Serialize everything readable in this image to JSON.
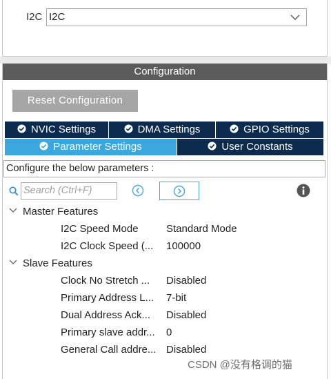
{
  "mode": {
    "label": "I2C",
    "selected": "I2C"
  },
  "config": {
    "header": "Configuration",
    "reset_button": "Reset Configuration",
    "tabs": [
      {
        "label": "NVIC Settings",
        "checked": true,
        "active": false
      },
      {
        "label": "DMA Settings",
        "checked": true,
        "active": false
      },
      {
        "label": "GPIO Settings",
        "checked": true,
        "active": false
      },
      {
        "label": "Parameter Settings",
        "checked": true,
        "active": true
      },
      {
        "label": "User Constants",
        "checked": true,
        "active": false
      }
    ],
    "description": "Configure the below parameters :",
    "search_placeholder": "Search (Ctrl+F)"
  },
  "tree": {
    "master": {
      "title": "Master Features",
      "params": [
        {
          "name": "I2C Speed Mode",
          "value": "Standard Mode"
        },
        {
          "name": "I2C Clock Speed (...",
          "value": "100000"
        }
      ]
    },
    "slave": {
      "title": "Slave Features",
      "params": [
        {
          "name": "Clock No Stretch ...",
          "value": "Disabled"
        },
        {
          "name": "Primary Address L...",
          "value": "7-bit"
        },
        {
          "name": "Dual Address Ack...",
          "value": "Disabled"
        },
        {
          "name": "Primary slave addr...",
          "value": "0"
        },
        {
          "name": "General Call addre...",
          "value": "Disabled"
        }
      ]
    }
  },
  "watermark": "CSDN @没有格调的猫",
  "colors": {
    "header_bg": "#5c5c5c",
    "tab_dark": "#0c2b4e",
    "tab_active": "#3aa7df",
    "reset_bg": "#a6a6a6",
    "accent_icon": "#4aa3df"
  },
  "icons": {
    "chevron": "chevron-down-icon",
    "tab_check": "check-circle-icon",
    "search": "search-icon",
    "prev": "chevron-left-circle-icon",
    "next": "chevron-right-circle-icon",
    "info": "info-icon",
    "expand": "caret-down-icon"
  }
}
